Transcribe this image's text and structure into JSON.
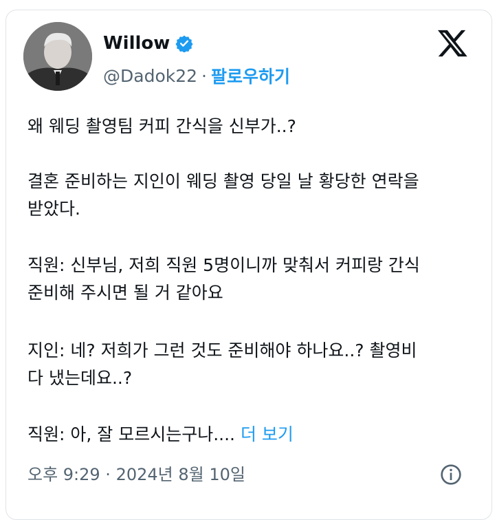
{
  "user": {
    "name": "Willow",
    "handle": "@Dadok22",
    "separator": "·",
    "follow_label": "팔로우하기"
  },
  "icons": {
    "verified": "verified-badge-icon",
    "x_logo": "x-logo-icon",
    "info": "info-icon",
    "verified_color": "#1d9bf0"
  },
  "post": {
    "line1": "왜 웨딩 촬영팀 커피 간식을 신부가..?",
    "line2": "결혼 준비하는 지인이 웨딩 촬영 당일 날 황당한 연락을",
    "line3": "받았다.",
    "line4": "직원: 신부님, 저희 직원 5명이니까 맞춰서 커피랑 간식",
    "line5": "준비해 주시면 될 거 같아요",
    "line6": "지인: 네? 저희가 그런 것도 준비해야 하나요..? 촬영비",
    "line7": "다 냈는데요..?",
    "line8": "직원: 아, 잘 모르시는구나....",
    "more_label": "더 보기"
  },
  "timestamp": "오후 9:29 · 2024년 8월 10일"
}
